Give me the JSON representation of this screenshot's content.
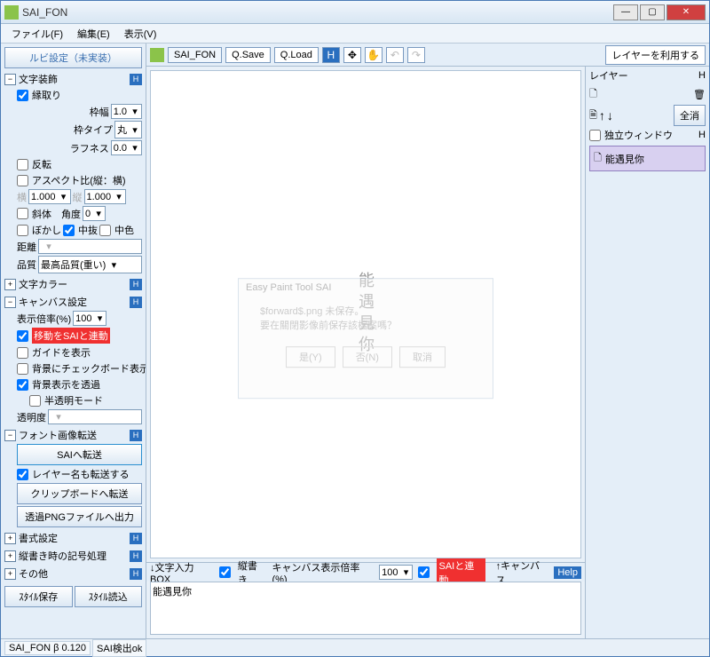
{
  "titlebar": {
    "title": "SAI_FON"
  },
  "menubar": {
    "file": "ファイル(F)",
    "edit": "編集(E)",
    "view": "表示(V)"
  },
  "toolbar": {
    "tab": "SAI_FON",
    "qsave": "Q.Save",
    "qload": "Q.Load",
    "layer_use": "レイヤーを利用する"
  },
  "sidebar": {
    "ruby": "ルビ設定（未実装）",
    "text_deco": "文字装飾",
    "border_chk": "縁取り",
    "border_width_lbl": "枠幅",
    "border_width": "1.0",
    "border_type_lbl": "枠タイプ",
    "border_type": "丸",
    "roughness_lbl": "ラフネス",
    "roughness": "0.0",
    "flip": "反転",
    "aspect_lbl": "アスペクト比(縦：横)",
    "aspect_wide_lbl": "横",
    "aspect_wide": "1.000",
    "aspect_tall_lbl": "縦",
    "aspect_tall": "1.000",
    "italic_lbl": "斜体　角度",
    "italic_angle": "0",
    "blur": "ぼかし",
    "hollow": "中抜",
    "midcolor": "中色",
    "distance_lbl": "距離",
    "quality_lbl": "品質",
    "quality_val": "最高品質(重い)",
    "text_color": "文字カラー",
    "canvas_setting": "キャンバス設定",
    "disp_zoom_lbl": "表示倍率(%)",
    "disp_zoom": "100",
    "link_move": "移動をSAIと連動",
    "show_guide": "ガイドを表示",
    "bg_checker": "背景にチェックボード表示",
    "bg_trans": "背景表示を透過",
    "semi_trans": "半透明モード",
    "opacity_lbl": "透明度",
    "font_xfer": "フォント画像転送",
    "send_to_sai": "SAIへ転送",
    "send_layer_name": "レイヤー名も転送する",
    "send_clipboard": "クリップボードへ転送",
    "export_png": "透過PNGファイルへ出力",
    "format_setting": "書式設定",
    "tate_symbol": "縦書き時の記号処理",
    "other": "その他",
    "style_save": "ｽﾀｲﾙ保存",
    "style_load": "ｽﾀｲﾙ読込"
  },
  "canvas": {
    "text": "能遇見你"
  },
  "ghost": {
    "title": "Easy Paint Tool SAI",
    "msg1": "$forward$.png 未保存。",
    "msg2": "要在關閉影像前保存該檔案嗎？",
    "yes": "是(Y)",
    "no": "否(N)",
    "cancel": "取消"
  },
  "bottom": {
    "input_box": "↓文字入力BOX",
    "vertical": "縦書き",
    "canvas_zoom_lbl": "キャンバス表示倍率(%)",
    "canvas_zoom": "100",
    "sai_link": "SAIと連動",
    "to_canvas": "↑キャンバス",
    "help": "Help"
  },
  "text_input": "能遇見你",
  "right": {
    "panel_title": "レイヤー",
    "clear_all": "全消",
    "independent": "独立ウィンドウ",
    "layer0": "能遇見你"
  },
  "status": {
    "ver": "SAI_FON β 0.120",
    "detect": "SAI検出ok"
  }
}
